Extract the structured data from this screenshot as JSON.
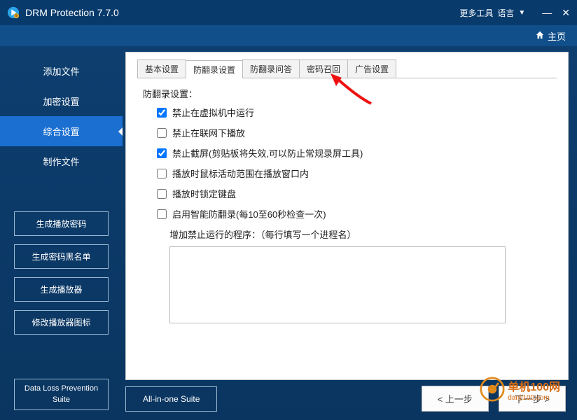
{
  "titlebar": {
    "title": "DRM Protection 7.7.0",
    "more_tools": "更多工具",
    "language": "语言"
  },
  "topbar": {
    "home": "主页"
  },
  "sidebar": {
    "nav": [
      {
        "label": "添加文件"
      },
      {
        "label": "加密设置"
      },
      {
        "label": "综合设置"
      },
      {
        "label": "制作文件"
      }
    ],
    "active_index": 2,
    "buttons": {
      "gen_play_pwd": "生成播放密码",
      "gen_pwd_blacklist": "生成密码黑名单",
      "gen_player": "生成播放器",
      "edit_player_icon": "修改播放器图标"
    },
    "suite_label": "Data Loss Prevention Suite"
  },
  "panel": {
    "tabs": [
      {
        "label": "基本设置"
      },
      {
        "label": "防翻录设置"
      },
      {
        "label": "防翻录问答"
      },
      {
        "label": "密码召回"
      },
      {
        "label": "广告设置"
      }
    ],
    "active_tab": 1,
    "section_title": "防翻录设置：",
    "options": [
      {
        "label": "禁止在虚拟机中运行",
        "checked": true
      },
      {
        "label": "禁止在联网下播放",
        "checked": false
      },
      {
        "label": "禁止截屏(剪贴板将失效,可以防止常规录屏工具)",
        "checked": true
      },
      {
        "label": "播放时鼠标活动范围在播放窗口内",
        "checked": false
      },
      {
        "label": "播放时锁定键盘",
        "checked": false
      },
      {
        "label": "启用智能防翻录(每10至60秒检查一次)",
        "checked": false
      }
    ],
    "sub_label": "增加禁止运行的程序：（每行填写一个进程名）",
    "proc_value": ""
  },
  "bottom": {
    "allinone": "All-in-one Suite",
    "prev": "< 上一步",
    "next": "下一步 >"
  },
  "watermark": {
    "text": "单机100网",
    "sub": "danji100.com"
  }
}
